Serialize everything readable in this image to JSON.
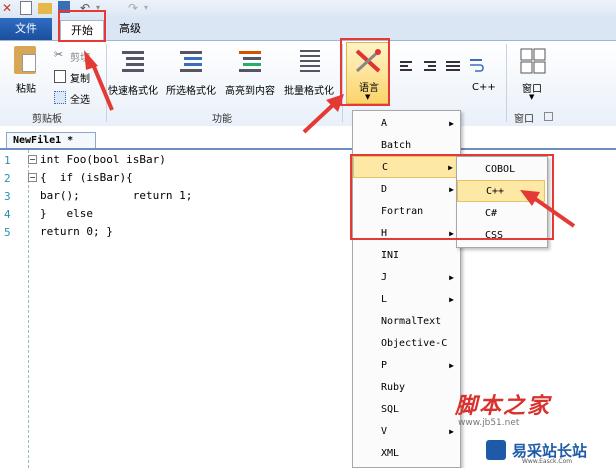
{
  "ribbon_tabs": {
    "file": "文件",
    "start": "开始",
    "advanced": "高级"
  },
  "clipboard": {
    "paste": "粘贴",
    "cut": "剪切",
    "copy": "复制",
    "select_all": "全选",
    "group_label": "剪贴板"
  },
  "function": {
    "quick_format": "快速格式化",
    "selected_format": "所选格式化",
    "highlight_content": "高亮到内容",
    "batch_format": "批量格式化",
    "group_label": "功能"
  },
  "language": {
    "label": "语言",
    "cpp_small": "C++"
  },
  "window": {
    "label": "窗口",
    "group_label": "窗口"
  },
  "document": {
    "tab": "NewFile1 *"
  },
  "code_lines": [
    {
      "num": "1",
      "text": "int Foo(bool isBar)"
    },
    {
      "num": "2",
      "text": "{  if (isBar){"
    },
    {
      "num": "3",
      "text": "bar();        return 1;"
    },
    {
      "num": "4",
      "text": "}   else"
    },
    {
      "num": "5",
      "text": "return 0; }"
    }
  ],
  "language_menu": [
    "A",
    "Batch",
    "C",
    "D",
    "Fortran",
    "H",
    "INI",
    "J",
    "L",
    "NormalText",
    "Objective-C",
    "P",
    "Ruby",
    "SQL",
    "V",
    "XML"
  ],
  "c_submenu": [
    "COBOL",
    "C++",
    "C#",
    "CSS"
  ],
  "watermark": {
    "brand": "脚本之家",
    "url": "www.jb51.net",
    "site": "易采站长站",
    "site_url": "Www.Easck.Com"
  },
  "colors": {
    "accent": "#1a4f9c",
    "highlight": "#fde9a5",
    "annotation": "#e53935"
  }
}
